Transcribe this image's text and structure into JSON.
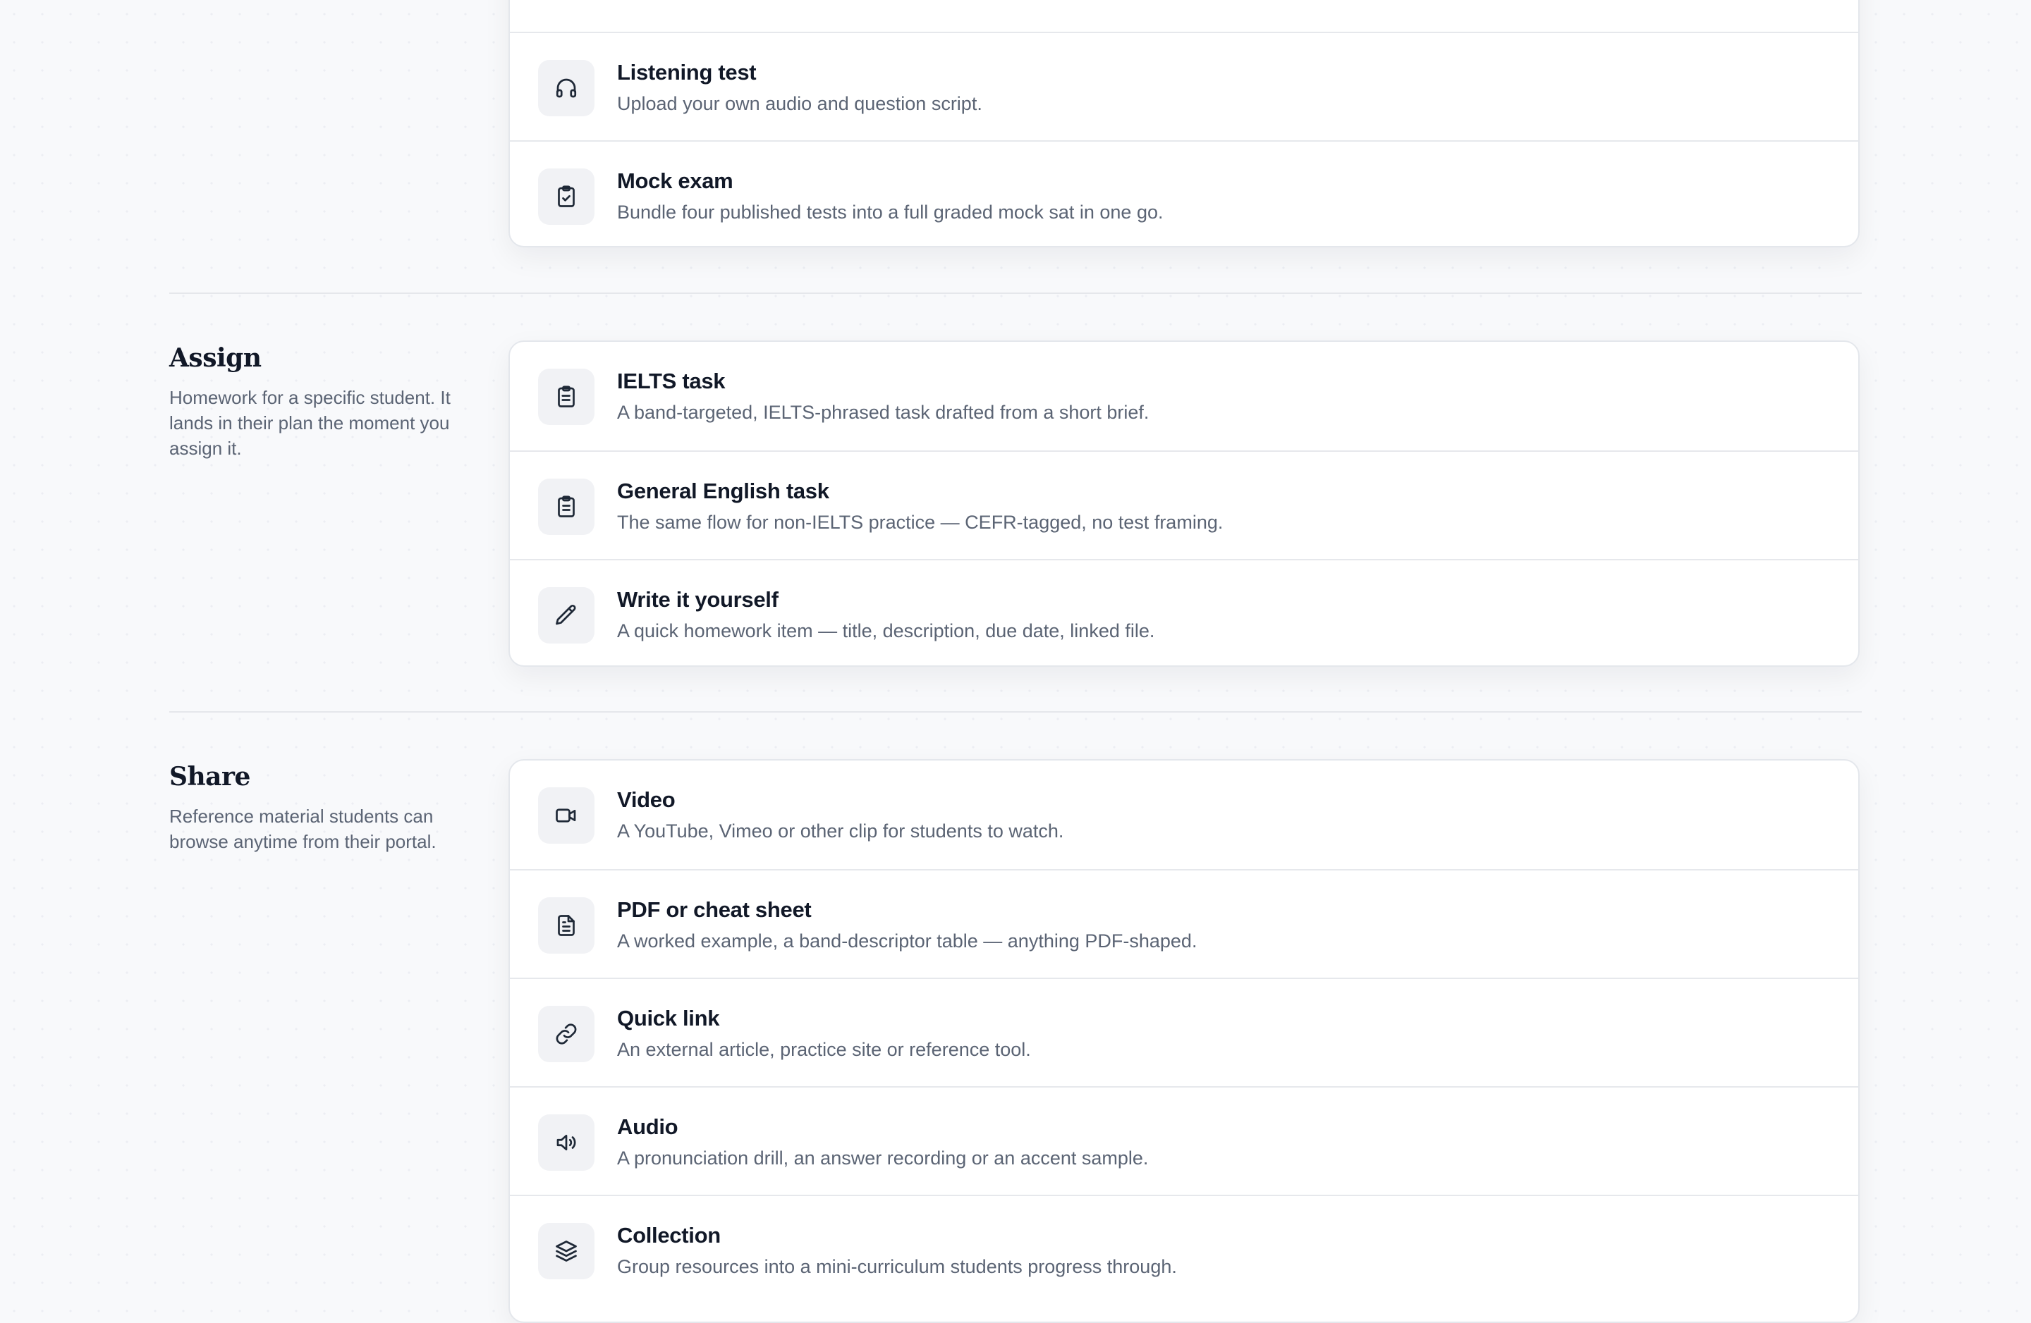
{
  "sections": {
    "build": {
      "items": [
        {
          "title": "Listening test",
          "description": "Upload your own audio and question script.",
          "icon": "headphones-icon"
        },
        {
          "title": "Mock exam",
          "description": "Bundle four published tests into a full graded mock sat in one go.",
          "icon": "clipboard-check-icon"
        }
      ]
    },
    "assign": {
      "title": "Assign",
      "description": "Homework for a specific student. It lands in their plan the moment you assign it.",
      "items": [
        {
          "title": "IELTS task",
          "description": "A band-targeted, IELTS-phrased task drafted from a short brief.",
          "icon": "clipboard-list-icon"
        },
        {
          "title": "General English task",
          "description": "The same flow for non-IELTS practice — CEFR-tagged, no test framing.",
          "icon": "clipboard-list-icon"
        },
        {
          "title": "Write it yourself",
          "description": "A quick homework item — title, description, due date, linked file.",
          "icon": "pencil-icon"
        }
      ]
    },
    "share": {
      "title": "Share",
      "description": "Reference material students can browse anytime from their portal.",
      "items": [
        {
          "title": "Video",
          "description": "A YouTube, Vimeo or other clip for students to watch.",
          "icon": "video-icon"
        },
        {
          "title": "PDF or cheat sheet",
          "description": "A worked example, a band-descriptor table — anything PDF-shaped.",
          "icon": "file-text-icon"
        },
        {
          "title": "Quick link",
          "description": "An external article, practice site or reference tool.",
          "icon": "link-icon"
        },
        {
          "title": "Audio",
          "description": "A pronunciation drill, an answer recording or an accent sample.",
          "icon": "speaker-icon"
        },
        {
          "title": "Collection",
          "description": "Group resources into a mini-curriculum students progress through.",
          "icon": "layers-icon"
        }
      ]
    }
  }
}
